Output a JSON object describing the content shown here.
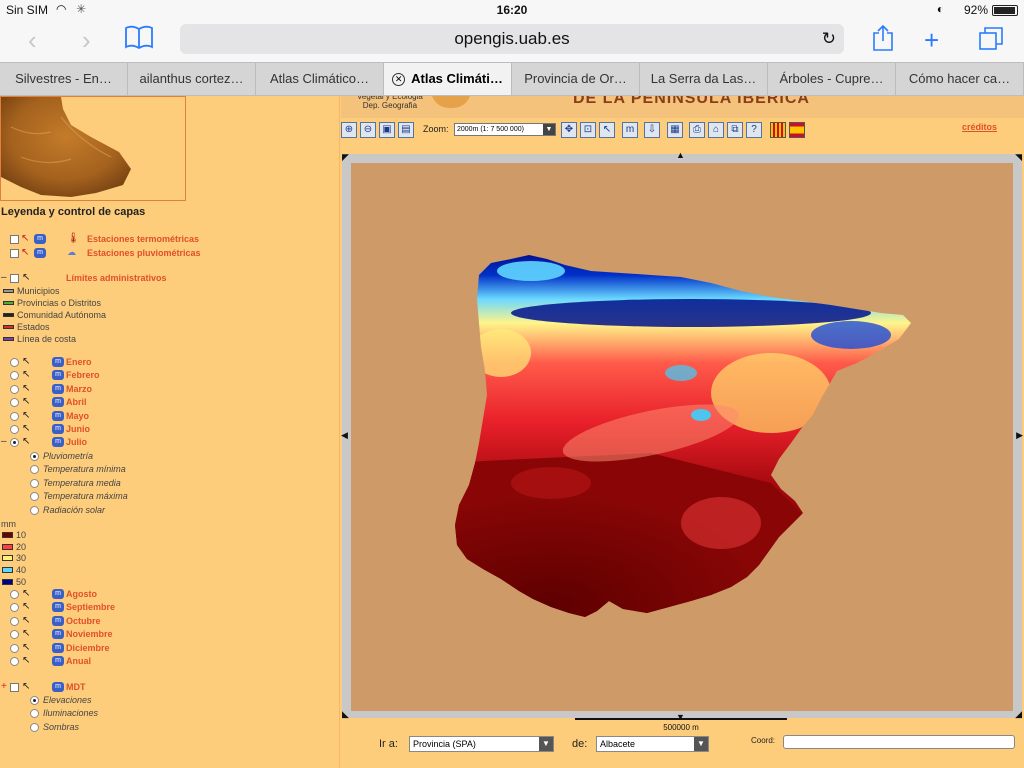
{
  "status": {
    "carrier": "Sin SIM",
    "time": "16:20",
    "battery": "92%"
  },
  "browser": {
    "url": "opengis.uab.es",
    "tabs": [
      {
        "label": "Silvestres - En…"
      },
      {
        "label": "ailanthus cortez…"
      },
      {
        "label": "Atlas Climático…"
      },
      {
        "label": "Atlas Climáti…"
      },
      {
        "label": "Provincia de Or…"
      },
      {
        "label": "La Serra da Las…"
      },
      {
        "label": "Árboles - Cupre…"
      },
      {
        "label": "Cómo hacer ca…"
      }
    ]
  },
  "banner": {
    "institution": "Vegetal y Ecologia\nDep. Geografia",
    "title": "DE LA PENÍNSULA IBÉRICA"
  },
  "map": {
    "zoom_label": "Zoom:",
    "zoom_value": "2000m (1: 7 500 000)",
    "credits": "créditos",
    "scale_label": "500000 m"
  },
  "legend": {
    "title": "Leyenda y control de capas",
    "stations": [
      {
        "label": "Estaciones termométricas"
      },
      {
        "label": "Estaciones pluviométricas"
      }
    ],
    "admin": {
      "label": "Límites administrativos",
      "items": [
        {
          "label": "Municipios",
          "color": "#999999"
        },
        {
          "label": "Provincias o Distritos",
          "color": "#4caf3a"
        },
        {
          "label": "Comunidad Autónoma",
          "color": "#222222"
        },
        {
          "label": "Estados",
          "color": "#d03030"
        },
        {
          "label": "Línea de costa",
          "color": "#7b3fb5"
        }
      ]
    },
    "months_top": [
      {
        "label": "Enero"
      },
      {
        "label": "Febrero"
      },
      {
        "label": "Marzo"
      },
      {
        "label": "Abril"
      },
      {
        "label": "Mayo"
      },
      {
        "label": "Junio"
      },
      {
        "label": "Julio"
      }
    ],
    "variables": [
      {
        "label": "Pluviometría",
        "selected": true
      },
      {
        "label": "Temperatura mínima"
      },
      {
        "label": "Temperatura media"
      },
      {
        "label": "Temperatura máxima"
      },
      {
        "label": "Radiación solar"
      }
    ],
    "unit": "mm",
    "scale": [
      {
        "label": "10",
        "color": "#6e0000"
      },
      {
        "label": "20",
        "color": "#ff4040"
      },
      {
        "label": "30",
        "color": "#fff07a"
      },
      {
        "label": "40",
        "color": "#5ad8ff"
      },
      {
        "label": "50",
        "color": "#00008b"
      }
    ],
    "months_bottom": [
      {
        "label": "Agosto"
      },
      {
        "label": "Septiembre"
      },
      {
        "label": "Octubre"
      },
      {
        "label": "Noviembre"
      },
      {
        "label": "Diciembre"
      },
      {
        "label": "Anual"
      }
    ],
    "mdt": {
      "label": "MDT",
      "options": [
        {
          "label": "Elevaciones",
          "selected": true
        },
        {
          "label": "Iluminaciones"
        },
        {
          "label": "Sombras"
        }
      ]
    }
  },
  "bottom": {
    "ir_label": "Ir a:",
    "ir_value": "Provincia (SPA)",
    "de_label": "de:",
    "de_value": "Albacete",
    "coord_label": "Coord:"
  }
}
